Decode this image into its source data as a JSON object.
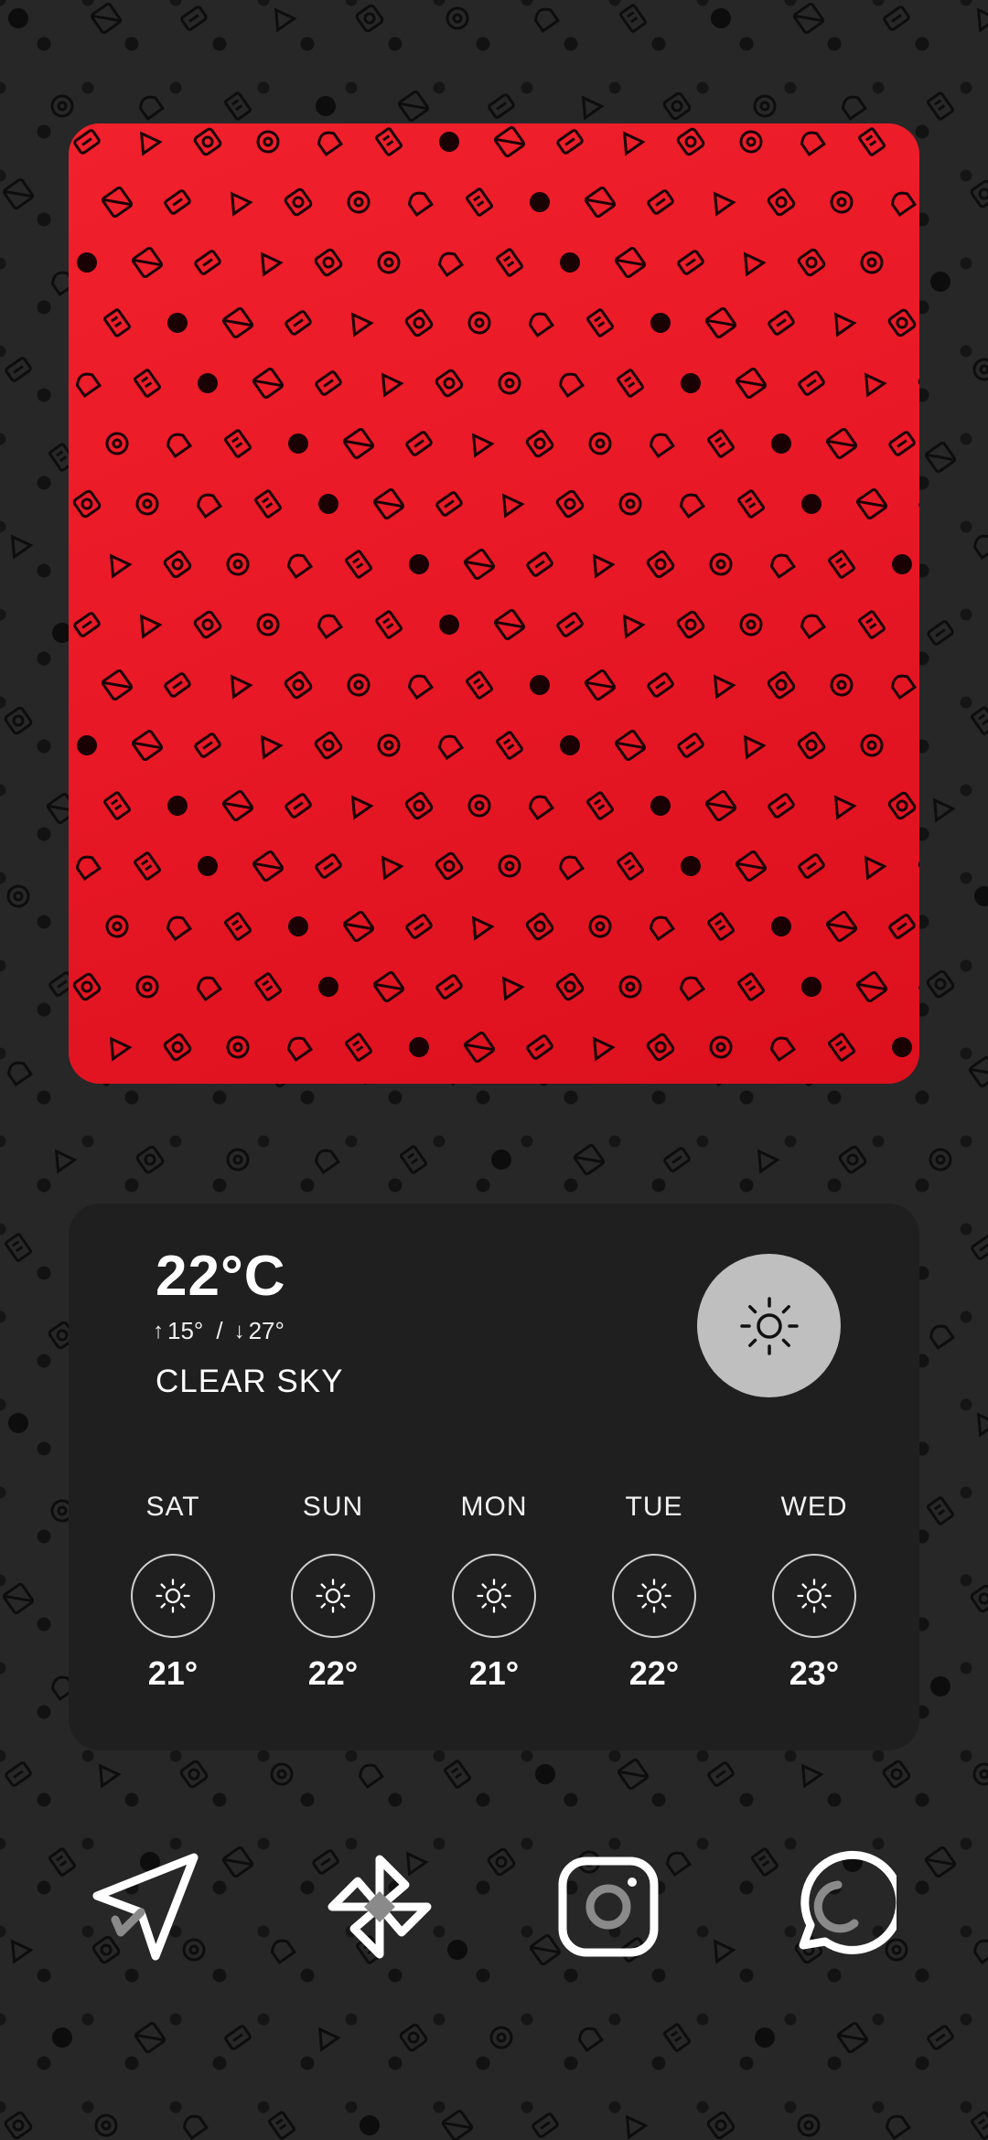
{
  "wallpaper": {
    "background_color": "#272727",
    "pattern_color": "#0d0d0d"
  },
  "photo_widget": {
    "background_color": "#e81826",
    "pattern_color": "#1a0204"
  },
  "weather": {
    "current_temp": "22°C",
    "low": "15°",
    "separator": "/",
    "high": "27°",
    "condition": "CLEAR SKY",
    "current_icon": "sun-icon",
    "forecast": [
      {
        "day": "SAT",
        "temp": "21°",
        "icon": "sun-icon"
      },
      {
        "day": "SUN",
        "temp": "22°",
        "icon": "sun-icon"
      },
      {
        "day": "MON",
        "temp": "21°",
        "icon": "sun-icon"
      },
      {
        "day": "TUE",
        "temp": "22°",
        "icon": "sun-icon"
      },
      {
        "day": "WED",
        "temp": "23°",
        "icon": "sun-icon"
      }
    ]
  },
  "dock": {
    "apps": [
      {
        "name": "send",
        "icon": "paper-plane-icon"
      },
      {
        "name": "photos",
        "icon": "pinwheel-icon"
      },
      {
        "name": "instagram",
        "icon": "camera-icon"
      },
      {
        "name": "whatsapp",
        "icon": "chat-bubble-icon"
      }
    ]
  }
}
